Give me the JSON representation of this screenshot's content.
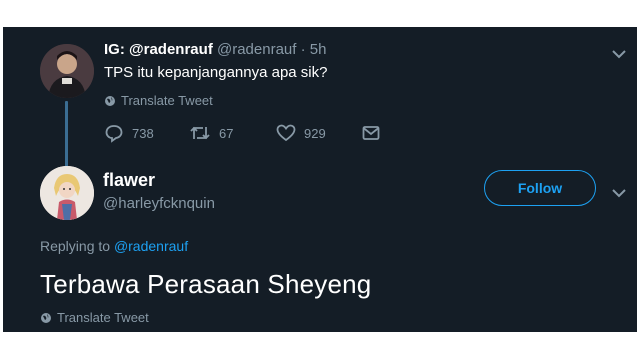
{
  "tweet1": {
    "display_name": "IG: @radenrauf",
    "handle": "@radenrauf",
    "separator": "·",
    "time": "5h",
    "text": "TPS itu kepanjangannya apa sik?",
    "translate_label": "Translate Tweet",
    "actions": {
      "reply_count": "738",
      "retweet_count": "67",
      "like_count": "929"
    },
    "icons": [
      "reply-icon",
      "retweet-icon",
      "like-icon",
      "message-icon",
      "globe-icon",
      "chevron-down-icon"
    ]
  },
  "tweet2": {
    "display_name": "flawer",
    "handle": "@harleyfcknquin",
    "follow_label": "Follow",
    "replying_prefix": "Replying to",
    "replying_handle": "@radenrauf",
    "text": "Terbawa Perasaan Sheyeng",
    "translate_label": "Translate Tweet"
  },
  "colors": {
    "background": "#141d26",
    "accent": "#1da1f2",
    "muted_text": "#8899a6",
    "thread_line": "#3b6d92"
  }
}
